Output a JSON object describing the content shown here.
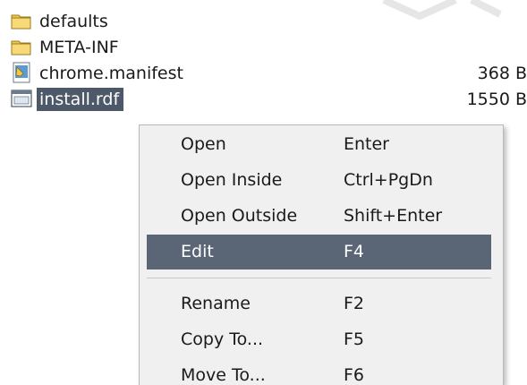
{
  "files": [
    {
      "name": "defaults",
      "size": "",
      "icon": "folder-icon"
    },
    {
      "name": "META-INF",
      "size": "",
      "icon": "folder-icon"
    },
    {
      "name": "chrome.manifest",
      "size": "368 B",
      "icon": "manifest-file-icon"
    },
    {
      "name": "install.rdf",
      "size": "1550 B",
      "icon": "rdf-file-icon",
      "selected": true
    }
  ],
  "context_menu": {
    "items": [
      {
        "label": "Open",
        "shortcut": "Enter"
      },
      {
        "label": "Open Inside",
        "shortcut": "Ctrl+PgDn"
      },
      {
        "label": "Open Outside",
        "shortcut": "Shift+Enter"
      },
      {
        "label": "Edit",
        "shortcut": "F4",
        "highlighted": true
      },
      {
        "label": "Rename",
        "shortcut": "F2"
      },
      {
        "label": "Copy To...",
        "shortcut": "F5"
      },
      {
        "label": "Move To...",
        "shortcut": "F6"
      }
    ]
  },
  "colors": {
    "selection": "#4d5969",
    "menu_highlight": "#5a6676",
    "menu_background": "#f0f0f0",
    "folder": "#f2c94c"
  }
}
